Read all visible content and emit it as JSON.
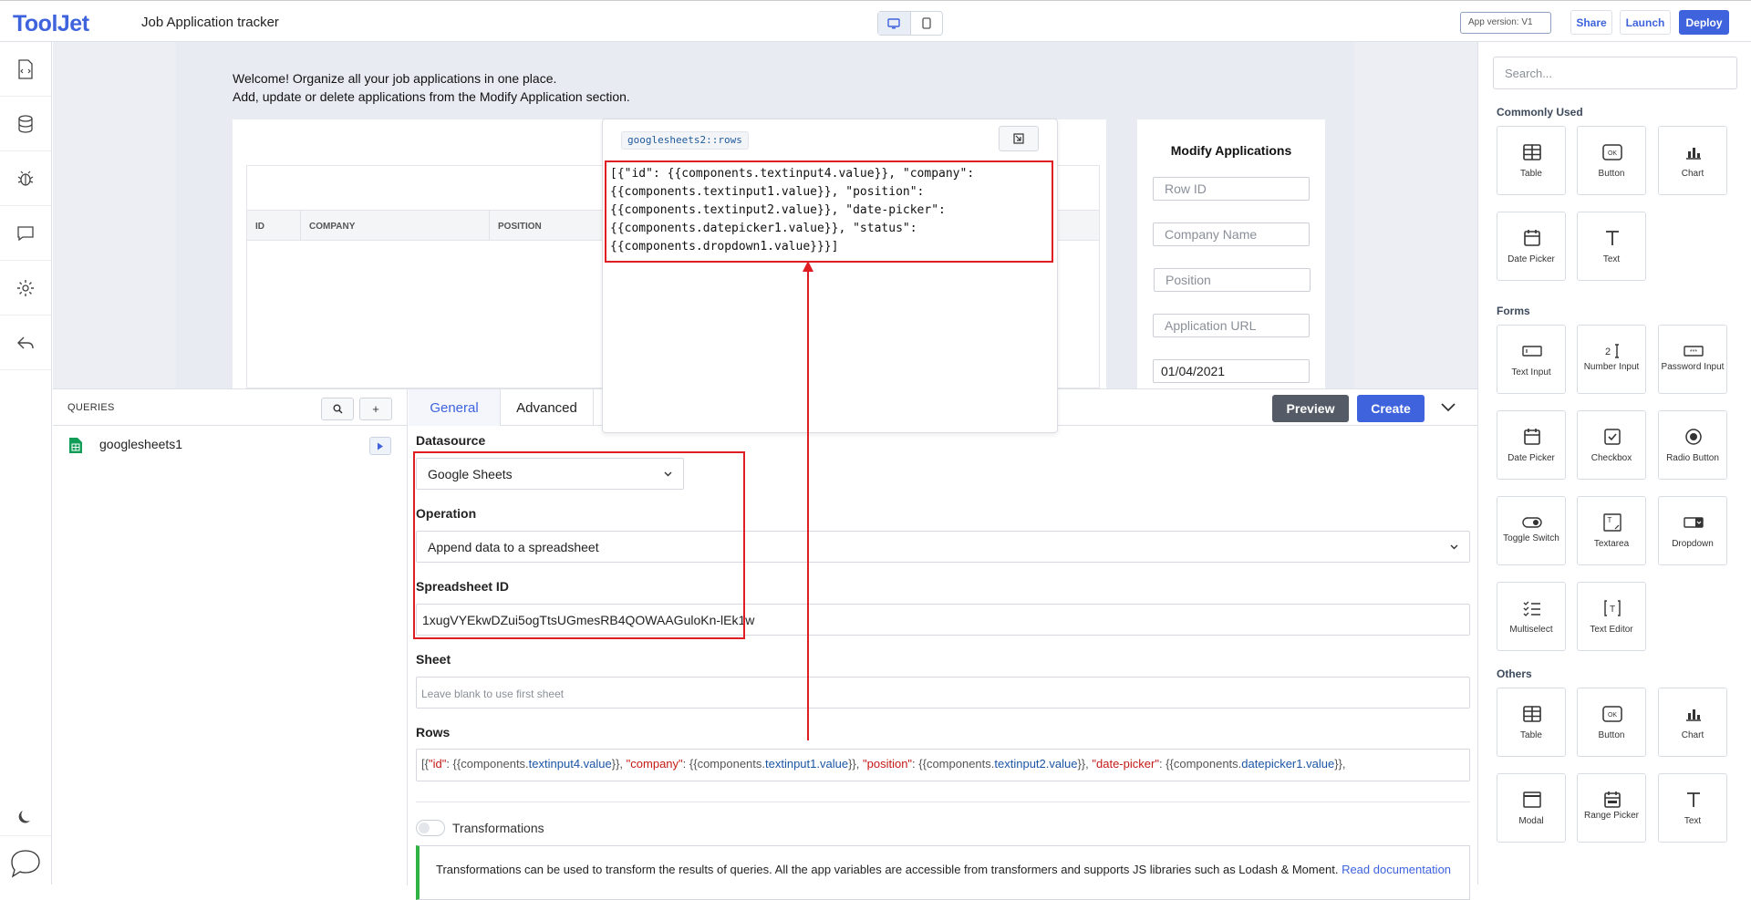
{
  "app": {
    "logo": "ToolJet",
    "title": "Job Application tracker",
    "version": "App version: V1"
  },
  "topbar": {
    "share": "Share",
    "launch": "Launch",
    "deploy": "Deploy"
  },
  "canvas": {
    "welcome_line1": "Welcome! Organize all your job applications in one place.",
    "welcome_line2": "Add, update or delete applications from the Modify Application section.",
    "table_columns": [
      "ID",
      "COMPANY",
      "POSITION"
    ],
    "modify": {
      "title": "Modify Applications",
      "placeholders": [
        "Row ID",
        "Company Name",
        "Position",
        "Application URL"
      ],
      "date_value": "01/04/2021"
    }
  },
  "popup": {
    "tag": "googlesheets2::rows",
    "code_lines": [
      "[{\"id\": {{components.textinput4.value}}, \"company\":",
      "{{components.textinput1.value}}, \"position\":",
      "{{components.textinput2.value}}, \"date-picker\":",
      "{{components.datepicker1.value}}, \"status\":",
      "{{components.dropdown1.value}}}]"
    ]
  },
  "queries": {
    "title": "QUERIES",
    "items": [
      {
        "name": "googlesheets1"
      }
    ]
  },
  "editor": {
    "tabs": [
      "General",
      "Advanced"
    ],
    "preview": "Preview",
    "create": "Create",
    "datasource_label": "Datasource",
    "datasource_value": "Google Sheets",
    "operation_label": "Operation",
    "operation_value": "Append data to a spreadsheet",
    "spreadsheet_label": "Spreadsheet ID",
    "spreadsheet_value": "1xugVYEkwDZui5ogTtsUGmesRB4QOWAAGuloKn-lEk1w",
    "sheet_label": "Sheet",
    "sheet_placeholder": "Leave blank to use first sheet",
    "rows_label": "Rows",
    "rows_value": [
      {
        "t": "[{",
        "c": "p"
      },
      {
        "t": "\"id\"",
        "c": "k"
      },
      {
        "t": ": {{components.",
        "c": "p"
      },
      {
        "t": "textinput4.value",
        "c": "v"
      },
      {
        "t": "}}, ",
        "c": "p"
      },
      {
        "t": "\"company\"",
        "c": "k"
      },
      {
        "t": ": {{components.",
        "c": "p"
      },
      {
        "t": "textinput1.value",
        "c": "v"
      },
      {
        "t": "}}, ",
        "c": "p"
      },
      {
        "t": "\"position\"",
        "c": "k"
      },
      {
        "t": ": {{components.",
        "c": "p"
      },
      {
        "t": "textinput2.value",
        "c": "v"
      },
      {
        "t": "}}, ",
        "c": "p"
      },
      {
        "t": "\"date-picker\"",
        "c": "k"
      },
      {
        "t": ": {{components.",
        "c": "p"
      },
      {
        "t": "datepicker1.value",
        "c": "v"
      },
      {
        "t": "}},",
        "c": "p"
      }
    ],
    "transformations_label": "Transformations",
    "transformations_info": "Transformations can be used to transform the results of queries. All the app variables are accessible from transformers and supports JS libraries such as Lodash & Moment.",
    "read_docs": "Read documentation"
  },
  "widgets": {
    "search_placeholder": "Search...",
    "sections": [
      {
        "title": "Commonly Used",
        "items": [
          {
            "label": "Table",
            "icon": "table-icon"
          },
          {
            "label": "Button",
            "icon": "button-icon"
          },
          {
            "label": "Chart",
            "icon": "chart-icon"
          },
          {
            "label": "Date Picker",
            "icon": "calendar-icon"
          },
          {
            "label": "Text",
            "icon": "text-icon"
          }
        ]
      },
      {
        "title": "Forms",
        "items": [
          {
            "label": "Text Input",
            "icon": "text-input-icon"
          },
          {
            "label": "Number Input",
            "icon": "number-input-icon"
          },
          {
            "label": "Password Input",
            "icon": "password-icon"
          },
          {
            "label": "Date Picker",
            "icon": "calendar-icon"
          },
          {
            "label": "Checkbox",
            "icon": "checkbox-icon"
          },
          {
            "label": "Radio Button",
            "icon": "radio-icon"
          },
          {
            "label": "Toggle Switch",
            "icon": "toggle-icon"
          },
          {
            "label": "Textarea",
            "icon": "textarea-icon"
          },
          {
            "label": "Dropdown",
            "icon": "dropdown-icon"
          },
          {
            "label": "Multiselect",
            "icon": "multiselect-icon"
          },
          {
            "label": "Text Editor",
            "icon": "text-editor-icon"
          }
        ]
      },
      {
        "title": "Others",
        "items": [
          {
            "label": "Table",
            "icon": "table-icon"
          },
          {
            "label": "Button",
            "icon": "button-icon"
          },
          {
            "label": "Chart",
            "icon": "chart-icon"
          },
          {
            "label": "Modal",
            "icon": "modal-icon"
          },
          {
            "label": "Range Picker",
            "icon": "range-picker-icon"
          },
          {
            "label": "Text",
            "icon": "text-icon"
          }
        ]
      }
    ]
  },
  "colors": {
    "accent": "#3e63dd",
    "highlight": "#e11d24",
    "preview": "#545b66"
  }
}
